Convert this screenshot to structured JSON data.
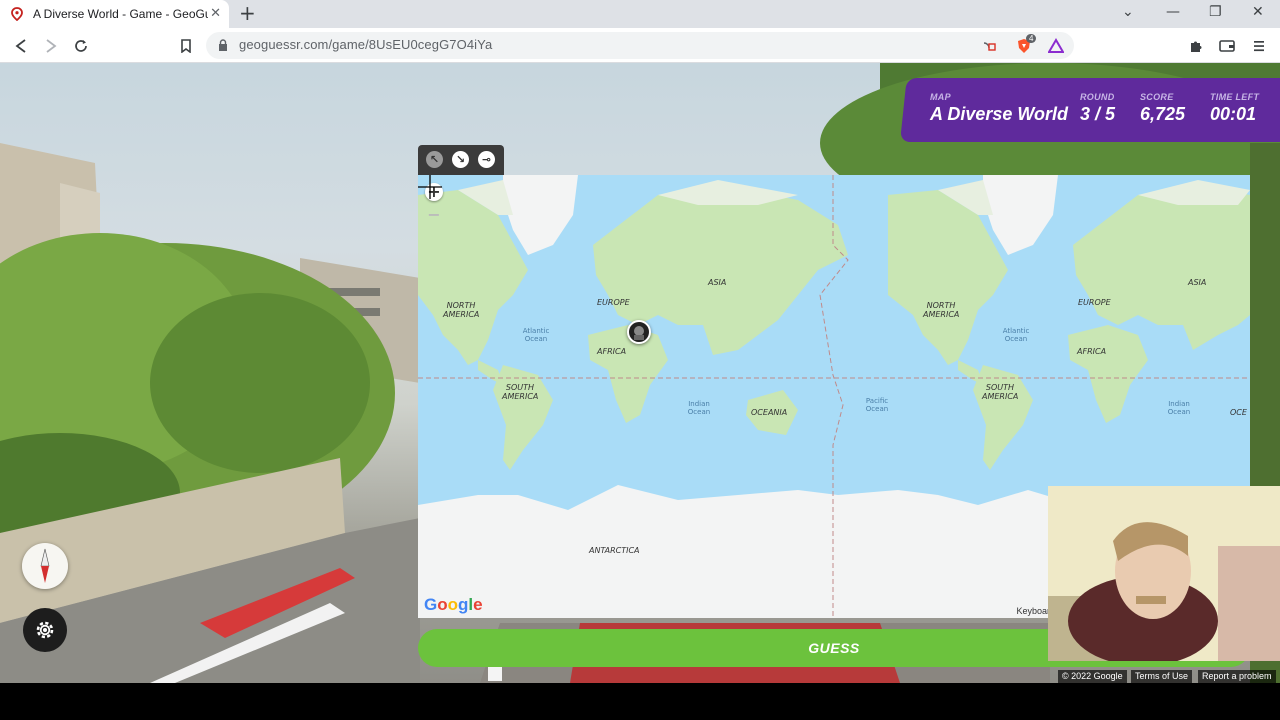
{
  "browser": {
    "tab_title": "A Diverse World - Game - GeoGuessr",
    "new_tab": "+",
    "url": "geoguessr.com/game/8UsEU0cegG7O4iYa",
    "window_controls": [
      "minimize-icon",
      "restore-icon",
      "close-icon"
    ],
    "extension_badge": "4"
  },
  "status": {
    "map_label": "MAP",
    "map_value": "A Diverse World",
    "round_label": "ROUND",
    "round_value": "3 / 5",
    "score_label": "SCORE",
    "score_value": "6,725",
    "time_label": "TIME LEFT",
    "time_value": "00:01",
    "accent": "#5f2a9c"
  },
  "map": {
    "controls": [
      "expand-icon",
      "shrink-icon",
      "pin-icon"
    ],
    "zoom_in": "+",
    "zoom_out": "−",
    "labels": {
      "north_america": "NORTH AMERICA",
      "south_america": "SOUTH AMERICA",
      "europe": "EUROPE",
      "asia": "ASIA",
      "africa": "AFRICA",
      "oceania": "OCEANIA",
      "antarctica": "ANTARCTICA",
      "atlantic": "Atlantic Ocean",
      "indian": "Indian Ocean",
      "pacific": "Pacific Ocean",
      "north_america_2": "NORTH AMERICA",
      "south_america_2": "SOUTH AMERICA",
      "europe_2": "EUROPE",
      "asia_2": "ASIA",
      "africa_2": "AFRICA",
      "oceania_2": "OCE",
      "atlantic_2": "Atlantic Ocean",
      "indian_2": "Indian Ocean"
    },
    "google": "Google",
    "keyboard": "Keyboar",
    "guess_button": "GUESS"
  },
  "attribution": {
    "copyright": "© 2022 Google",
    "terms": "Terms of Use",
    "report": "Report a problem"
  },
  "colors": {
    "guess": "#6cc23d",
    "ocean": "#a9dcf7",
    "land": "#c9e6b4",
    "ice": "#f3f4f4"
  }
}
